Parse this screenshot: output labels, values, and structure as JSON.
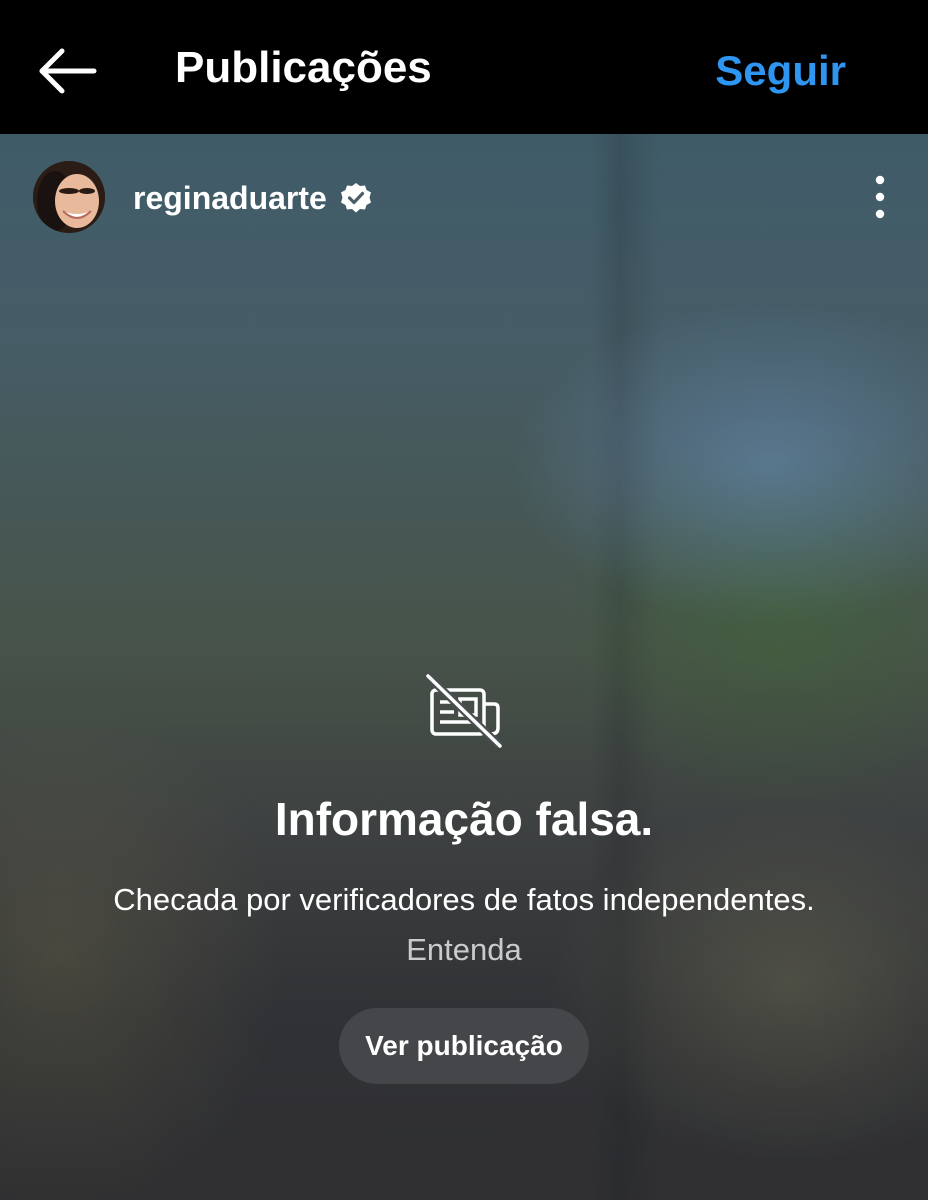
{
  "header": {
    "back_icon": "arrow-left-icon",
    "title": "Publicações",
    "follow_label": "Seguir",
    "accent_color": "#2e95f0"
  },
  "post": {
    "username": "reginaduarte",
    "verified_icon": "verified-badge-icon",
    "more_icon": "more-vertical-icon",
    "avatar_icon": "profile-avatar"
  },
  "warning": {
    "icon": "newspaper-slash-icon",
    "title": "Informação falsa.",
    "description": "Checada por verificadores de fatos independentes.",
    "learn_more": "Entenda",
    "view_button": "Ver publicação"
  }
}
